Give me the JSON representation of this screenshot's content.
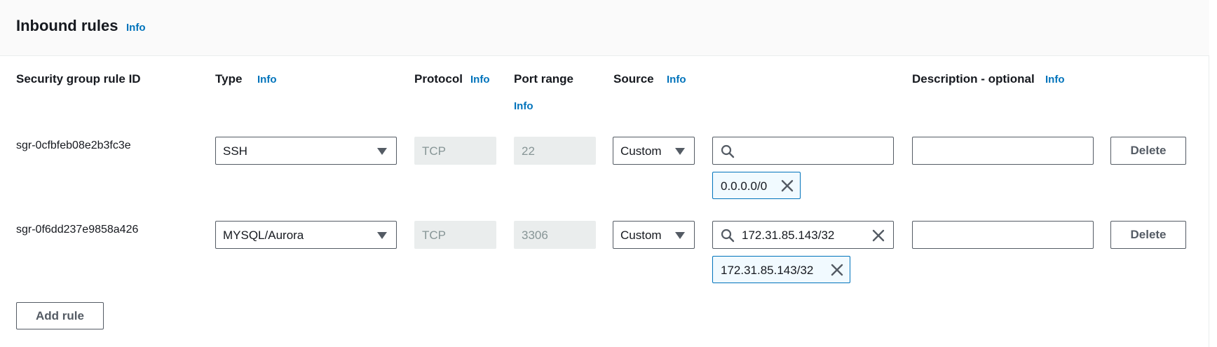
{
  "section": {
    "title": "Inbound rules",
    "info_label": "Info"
  },
  "columns": {
    "rule_id": "Security group rule ID",
    "type": "Type",
    "type_info": "Info",
    "protocol": "Protocol",
    "protocol_info": "Info",
    "port_range": "Port range",
    "port_range_info": "Info",
    "source": "Source",
    "source_info": "Info",
    "description": "Description - optional",
    "description_info": "Info"
  },
  "rules": [
    {
      "id": "sgr-0cfbfeb08e2b3fc3e",
      "type": "SSH",
      "protocol": "TCP",
      "port_range": "22",
      "source_type": "Custom",
      "source_search_value": "",
      "source_tokens": [
        "0.0.0.0/0"
      ],
      "description": "",
      "delete_label": "Delete"
    },
    {
      "id": "sgr-0f6dd237e9858a426",
      "type": "MYSQL/Aurora",
      "protocol": "TCP",
      "port_range": "3306",
      "source_type": "Custom",
      "source_search_value": "172.31.85.143/32",
      "source_tokens": [
        "172.31.85.143/32"
      ],
      "description": "",
      "delete_label": "Delete"
    }
  ],
  "add_rule_label": "Add rule",
  "colors": {
    "link": "#0073bb",
    "token_border": "#0073bb",
    "token_bg": "#f1faff",
    "disabled_bg": "#eaeded",
    "border": "#545b64"
  },
  "icons": {
    "search": "search-icon",
    "clear": "close-icon",
    "dropdown": "caret-down-icon"
  }
}
